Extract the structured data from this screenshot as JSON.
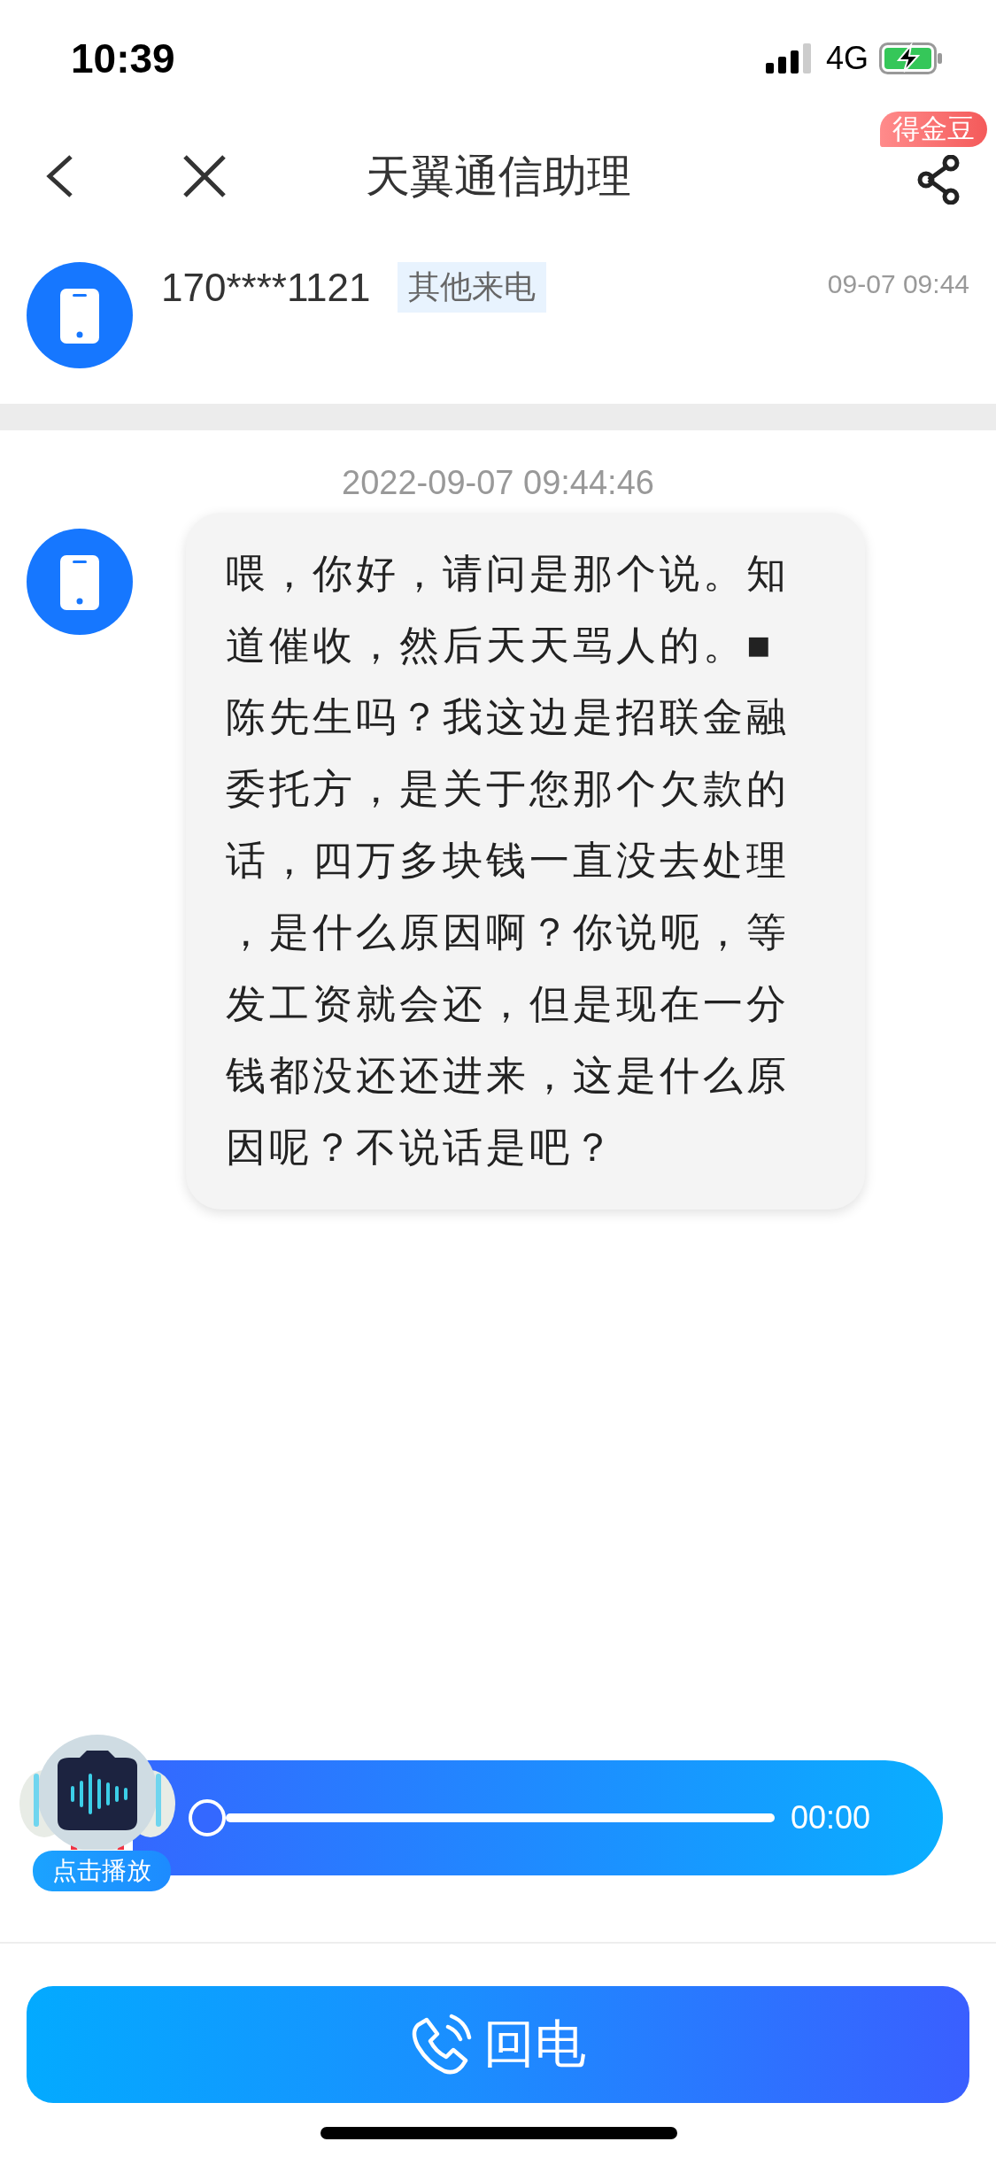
{
  "status_bar": {
    "time": "10:39",
    "network": "4G"
  },
  "nav": {
    "title": "天翼通信助理",
    "badge": "得金豆"
  },
  "caller": {
    "number": "170****1121",
    "tag": "其他来电",
    "time": "09-07 09:44"
  },
  "transcript": {
    "timestamp": "2022-09-07 09:44:46",
    "messages": [
      {
        "text": "喂，你好，请问是那个说。知道催收，然后天天骂人的。■陈先生吗？我这边是招联金融委托方，是关于您那个欠款的话，四万多块钱一直没去处理，是什么原因啊？你说呃，等发工资就会还，但是现在一分钱都没还还进来，这是什么原因呢？不说话是吧？"
      }
    ]
  },
  "player": {
    "label": "点击播放",
    "time": "00:00",
    "level": 0
  },
  "call_back": {
    "label": "回电"
  }
}
